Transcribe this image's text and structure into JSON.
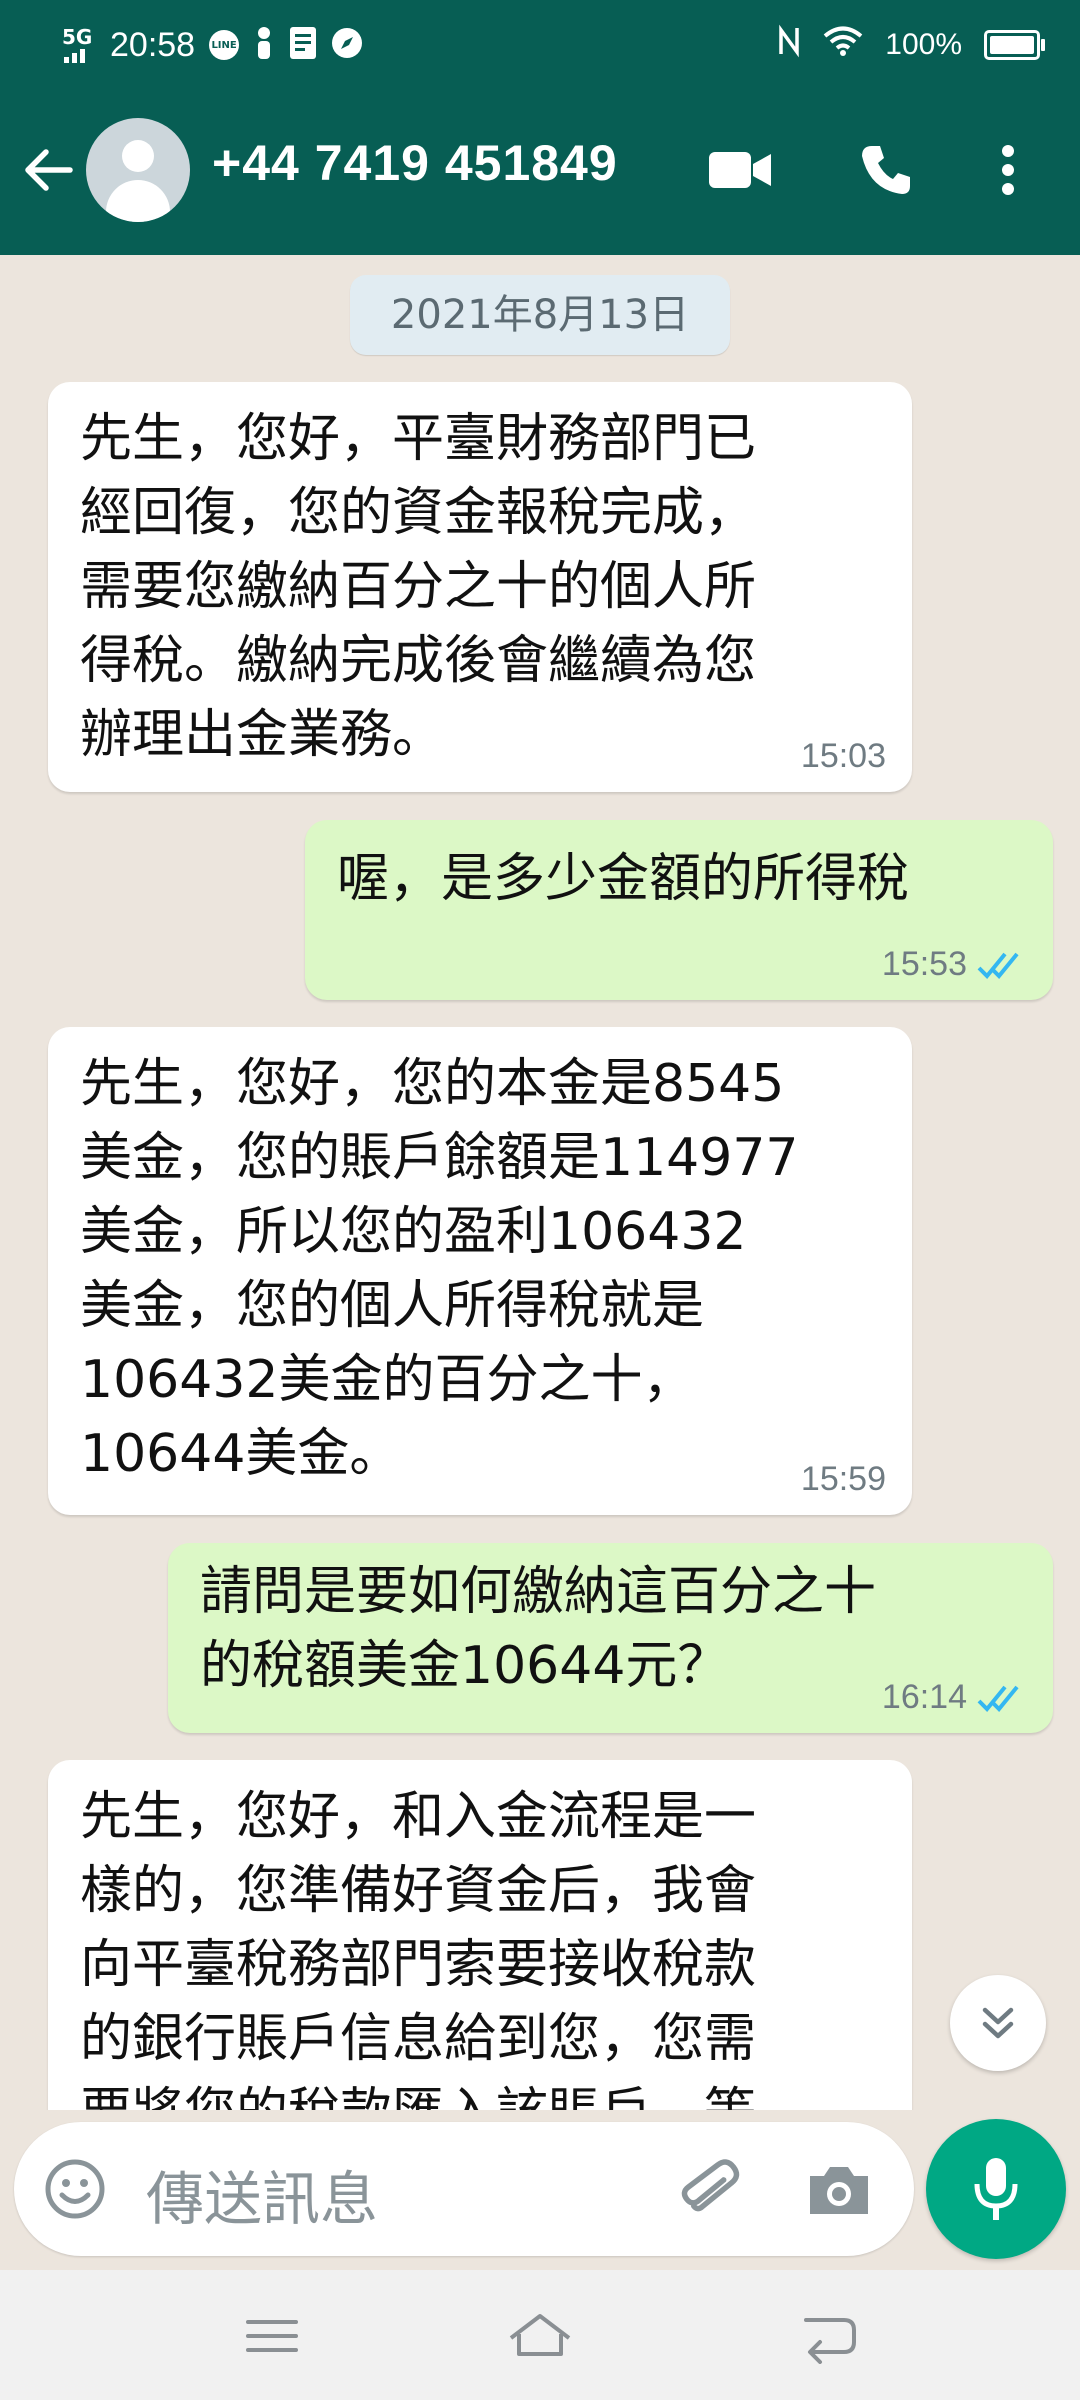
{
  "status_bar": {
    "network": "5G",
    "time": "20:58",
    "battery": "100%"
  },
  "header": {
    "contact": "+44 7419 451849"
  },
  "chat": {
    "date": "2021年8月13日",
    "messages": [
      {
        "dir": "in",
        "text": "先生，您好，平臺財務部門已\n經回復，您的資金報稅完成，\n需要您繳納百分之十的個人所\n得稅。繳納完成後會繼續為您\n辦理出金業務。",
        "time": "15:03"
      },
      {
        "dir": "out",
        "text": "喔，是多少金額的所得稅",
        "time": "15:53",
        "status": "read"
      },
      {
        "dir": "in",
        "text": "先生，您好，您的本金是8545\n美金，您的賬戶餘額是114977\n美金，所以您的盈利106432\n美金，您的個人所得稅就是\n106432美金的百分之十，\n10644美金。",
        "time": "15:59"
      },
      {
        "dir": "out",
        "text": "請問是要如何繳納這百分之十\n的稅額美金10644元？",
        "time": "16:14",
        "status": "read"
      },
      {
        "dir": "in",
        "text": "先生，您好，和入金流程是一\n樣的，您準備好資金后，我會\n向平臺稅務部門索要接收稅款\n的銀行賬戶信息給到您，您需\n要將您的稅款匯入該賬戶，等"
      }
    ]
  },
  "composer": {
    "placeholder": "傳送訊息"
  },
  "colors": {
    "header": "#075e54",
    "outgoing": "#dcf8c6",
    "incoming": "#ffffff",
    "accent": "#00a884",
    "read_ticks": "#34b7f1"
  }
}
